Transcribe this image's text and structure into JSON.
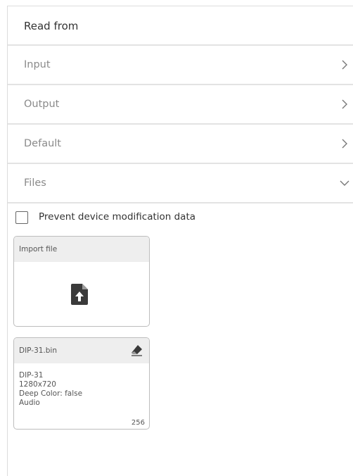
{
  "panel": {
    "title": "Read from"
  },
  "accordion": [
    {
      "label": "Input",
      "expanded": false,
      "chevron": "chevron-right-icon"
    },
    {
      "label": "Output",
      "expanded": false,
      "chevron": "chevron-right-icon"
    },
    {
      "label": "Default",
      "expanded": false,
      "chevron": "chevron-right-icon"
    },
    {
      "label": "Files",
      "expanded": true,
      "chevron": "chevron-down-icon"
    }
  ],
  "files_section": {
    "prevent_modification": {
      "label": "Prevent device modification data",
      "checked": false
    },
    "import_card": {
      "label": "Import file",
      "icon": "file-upload-icon"
    },
    "file_card": {
      "filename": "DIP-31.bin",
      "icon": "eraser-icon",
      "details": [
        "DIP-31",
        "1280x720",
        "Deep Color: false",
        "Audio"
      ],
      "count": "256"
    }
  }
}
